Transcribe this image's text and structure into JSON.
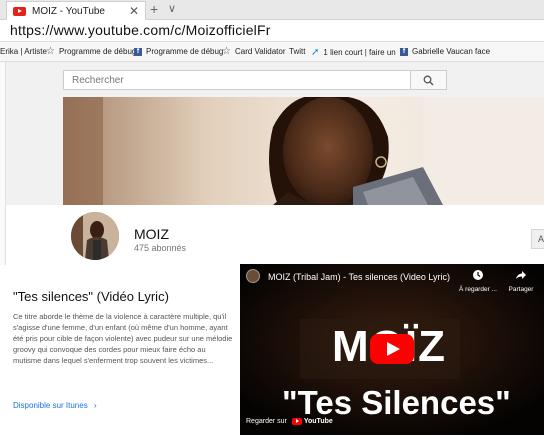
{
  "browser": {
    "tab_title": "MOIZ - YouTube",
    "tab_close": "✕",
    "new_tab": "+",
    "tab_list": "∨",
    "url": "https://www.youtube.com/c/MoizofficielFr"
  },
  "bookmarks": [
    {
      "label": "Erika | Artiste"
    },
    {
      "label": "Programme de débug"
    },
    {
      "label": "Programme de débug"
    },
    {
      "label": "Card Validator"
    },
    {
      "label": "Twitt"
    },
    {
      "label": "1 lien court | faire un"
    },
    {
      "label": "Gabrielle Vaucan face"
    }
  ],
  "search": {
    "placeholder": "Rechercher"
  },
  "channel": {
    "name": "MOIZ",
    "subscribers": "475 abonnés",
    "subscribe_label": "A"
  },
  "featured": {
    "title": "\"Tes silences\" (Vidéo Lyric)",
    "description": "Ce titre aborde le thème de la violence à caractère multiple, qu'il s'agisse d'une femme, d'un enfant (où même d'un homme, ayant été pris pour cible de façon violente) avec pudeur sur une mélodie groovy qui convoque des cordes pour mieux faire écho au mutisme dans lequel s'enferment trop souvent les victimes...",
    "itunes_label": "Disponible sur Itunes",
    "itunes_chevron": "›"
  },
  "player": {
    "video_title": "MOIZ (Tribal Jam) - Tes silences (Video Lyric)",
    "watch_later": "À regarder ...",
    "share": "Partager",
    "big_title_1": "MOÏZ",
    "big_title_2": "\"Tes Silences\"",
    "watch_on": "Regarder sur",
    "youtube_logo": "YouTube"
  }
}
